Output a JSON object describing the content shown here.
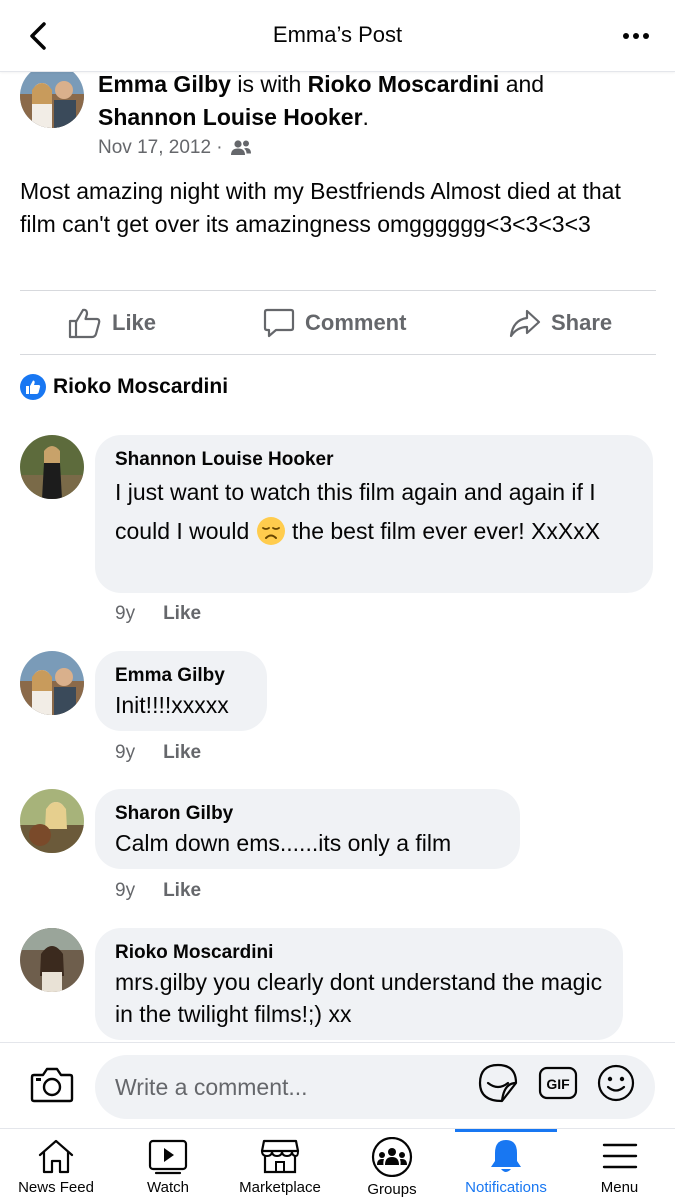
{
  "header": {
    "title": "Emma’s Post"
  },
  "post": {
    "author": "Emma Gilby",
    "with_word": " is with ",
    "tag1": "Rioko Moscardini",
    "and_word": " and ",
    "tag2": "Shannon Louise Hooker",
    "period": ".",
    "date": "Nov 17, 2012 ·",
    "privacy_icon": "friends-icon",
    "body": "Most amazing night with my Bestfriends Almost died at that film can't get over its amazingness omgggggg<3<3<3<3"
  },
  "actions": {
    "like": "Like",
    "comment": "Comment",
    "share": "Share"
  },
  "reactions": {
    "liked_by": "Rioko Moscardini"
  },
  "comments": [
    {
      "name": "Shannon Louise Hooker",
      "text_before": "I just want to watch this film again and again if I could I would ",
      "emoji": "disappointed-face",
      "text_after": " the best film ever ever! XxXxX",
      "age": "9y",
      "like": "Like"
    },
    {
      "name": "Emma Gilby",
      "text": "Init!!!!xxxxx",
      "age": "9y",
      "like": "Like"
    },
    {
      "name": "Sharon Gilby",
      "text": "Calm down ems......its only a film",
      "age": "9y",
      "like": "Like"
    },
    {
      "name": "Rioko Moscardini",
      "text": "mrs.gilby you clearly dont understand the magic in the twilight films!;)  xx"
    }
  ],
  "composer": {
    "placeholder": "Write a comment..."
  },
  "tabs": [
    {
      "label": "News Feed"
    },
    {
      "label": "Watch"
    },
    {
      "label": "Marketplace"
    },
    {
      "label": "Groups"
    },
    {
      "label": "Notifications"
    },
    {
      "label": "Menu"
    }
  ],
  "colors": {
    "accent": "#1877f2",
    "bubble": "#f0f2f5",
    "secondary_text": "#65676b"
  }
}
